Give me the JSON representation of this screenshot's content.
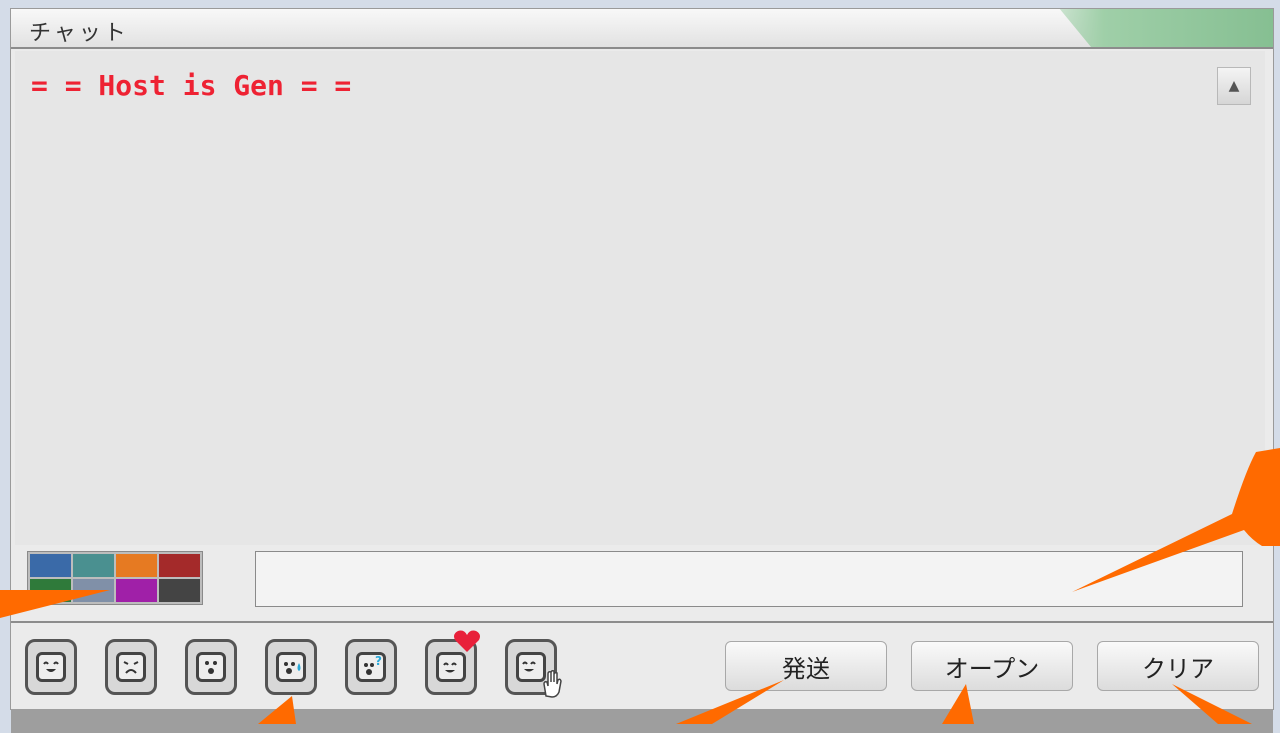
{
  "window": {
    "title": "チャット"
  },
  "chat": {
    "messages": [
      {
        "text": "= = Host is Gen = =",
        "color": "#ee2233"
      }
    ]
  },
  "palette": {
    "colors": [
      "#3a6aa8",
      "#4a9090",
      "#e67a22",
      "#a42a2a",
      "#2f7a3a",
      "#8090a8",
      "#a020a8",
      "#444444"
    ]
  },
  "input": {
    "value": "",
    "placeholder": ""
  },
  "emoticons": [
    {
      "icon": "smile-face-icon"
    },
    {
      "icon": "sad-face-icon"
    },
    {
      "icon": "surprised-face-icon"
    },
    {
      "icon": "sweat-face-icon"
    },
    {
      "icon": "question-face-icon"
    },
    {
      "icon": "love-face-icon"
    },
    {
      "icon": "wave-face-icon"
    }
  ],
  "buttons": {
    "send": "発送",
    "open": "オープン",
    "clear": "クリア"
  },
  "annotation_color": "#ff6a00"
}
